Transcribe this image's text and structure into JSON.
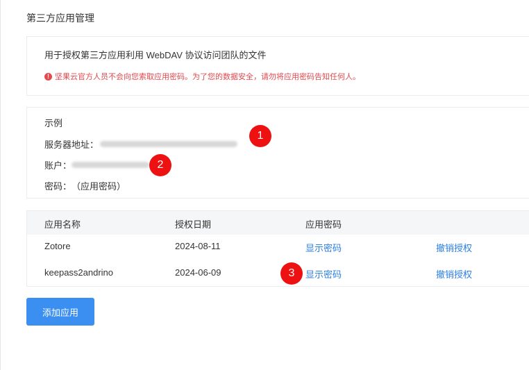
{
  "page": {
    "title": "第三方应用管理"
  },
  "intro": {
    "description": "用于授权第三方应用利用 WebDAV 协议访问团队的文件",
    "warning_icon": "!",
    "warning": "坚果云官方人员不会向您索取应用密码。为了您的数据安全，请勿将应用密码告知任何人。"
  },
  "example": {
    "heading": "示例",
    "server_label": "服务器地址：",
    "account_label": "账户：",
    "password_label": "密码：",
    "password_value": "（应用密码）"
  },
  "annotations": [
    "1",
    "2",
    "3"
  ],
  "table": {
    "headers": [
      "应用名称",
      "授权日期",
      "应用密码"
    ],
    "rows": [
      {
        "name": "Zotore",
        "date": "2024-08-11",
        "show_password": "显示密码",
        "revoke": "撤销授权"
      },
      {
        "name": "keepass2andrino",
        "date": "2024-06-09",
        "show_password": "显示密码",
        "revoke": "撤销授权"
      }
    ]
  },
  "add_button": "添加应用",
  "colors": {
    "link": "#2a7fe6",
    "primary": "#3b8ff0",
    "warning": "#e5484d",
    "badge": "#ee1111"
  }
}
